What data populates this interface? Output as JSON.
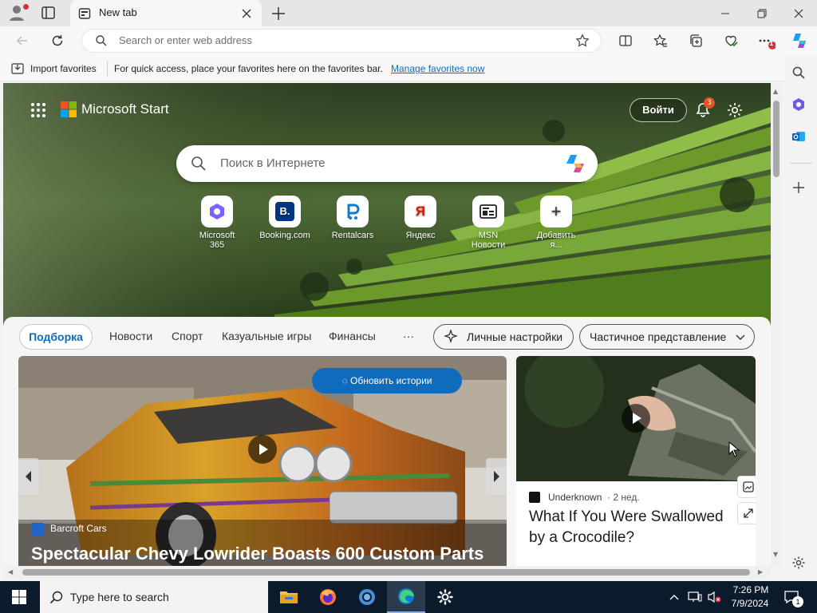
{
  "browser": {
    "tab_title": "New tab",
    "address_placeholder": "Search or enter web address",
    "notification_count": "1"
  },
  "favbar": {
    "import_label": "Import favorites",
    "hint": "For quick access, place your favorites here on the favorites bar.",
    "manage_link": "Manage favorites now"
  },
  "msn": {
    "brand": "Microsoft Start",
    "signin": "Войти",
    "bell_count": "3",
    "search_placeholder": "Поиск в Интернете",
    "shortcuts": [
      {
        "label": "Microsoft 365",
        "icon": "microsoft-365-icon"
      },
      {
        "label": "Booking.com",
        "icon": "booking-icon",
        "glyph": "B."
      },
      {
        "label": "Rentalcars",
        "icon": "rentalcars-icon"
      },
      {
        "label": "Яндекс",
        "icon": "yandex-icon",
        "glyph": "Я"
      },
      {
        "label": "MSN Новости",
        "icon": "msn-news-icon"
      },
      {
        "label": "Добавить я...",
        "icon": "add-icon",
        "glyph": "+"
      }
    ],
    "categories": [
      "Подборка",
      "Новости",
      "Спорт",
      "Казуальные игры",
      "Финансы",
      "···"
    ],
    "personal_settings": "Личные настройки",
    "view_mode": "Частичное представление",
    "refresh": "Обновить истории"
  },
  "cards": {
    "main": {
      "source": "Barcroft Cars",
      "title": "Spectacular Chevy Lowrider Boasts 600 Custom Parts"
    },
    "side": {
      "source": "Underknown",
      "age": "2 нед.",
      "title_line1": "What If You Were Swallowed",
      "title_line2": "by a Crocodile?"
    }
  },
  "taskbar": {
    "search_placeholder": "Type here to search",
    "time": "7:26 PM",
    "date": "7/9/2024",
    "notification_count": "1"
  },
  "colors": {
    "accent": "#0f6cbd",
    "link": "#0f6cbd",
    "badge": "#d13438",
    "taskbar": "#0c1b2c"
  }
}
